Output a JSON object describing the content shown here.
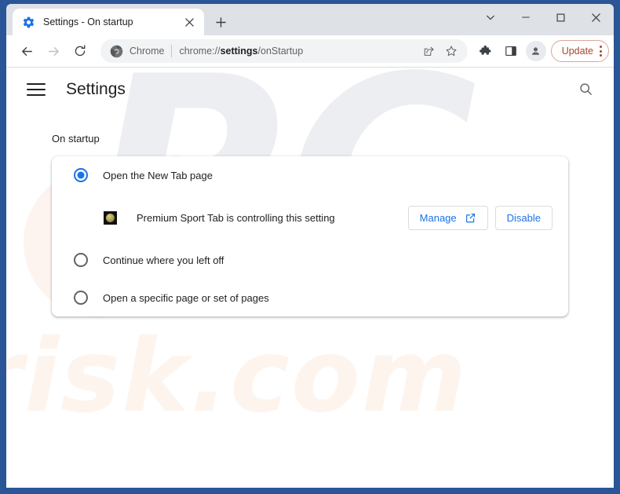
{
  "window": {
    "frame_color": "#2a5596",
    "titlebar_color": "#dee1e6",
    "controls": [
      {
        "name": "tab-search",
        "icon": "chevron-down-icon"
      },
      {
        "name": "minimize",
        "icon": "minimize-icon"
      },
      {
        "name": "maximize",
        "icon": "maximize-icon"
      },
      {
        "name": "close",
        "icon": "close-icon"
      }
    ]
  },
  "tab": {
    "favicon": "settings-gear-icon",
    "title": "Settings - On startup",
    "close_icon": "close-icon",
    "new_tab_icon": "plus-icon"
  },
  "toolbar": {
    "back_icon": "arrow-back-icon",
    "forward_icon": "arrow-forward-icon",
    "reload_icon": "reload-icon",
    "omnibox": {
      "chrome_icon": "chrome-logo-icon",
      "scheme_label": "Chrome",
      "url_prefix": "chrome://",
      "url_bold": "settings",
      "url_suffix": "/onStartup",
      "share_icon": "share-icon",
      "bookmark_icon": "star-icon"
    },
    "extensions_icon": "puzzle-icon",
    "side_panel_icon": "side-panel-icon",
    "profile_icon": "avatar-icon",
    "update_label": "Update",
    "update_menu_icon": "three-dots-vertical-icon",
    "update_color": "#a8452a"
  },
  "settings": {
    "menu_icon": "hamburger-icon",
    "title": "Settings",
    "search_icon": "search-icon",
    "section_label": "On startup",
    "accent_color": "#1a73e8",
    "options": [
      {
        "label": "Open the New Tab page",
        "selected": true
      },
      {
        "label": "Continue where you left off",
        "selected": false
      },
      {
        "label": "Open a specific page or set of pages",
        "selected": false
      }
    ],
    "extension_notice": {
      "icon": "extension-favicon",
      "text": "Premium Sport Tab is controlling this setting",
      "manage_label": "Manage",
      "manage_icon": "open-in-new-icon",
      "disable_label": "Disable"
    }
  },
  "watermark": {
    "big_text": "PC",
    "domain_text": "risk.com"
  }
}
